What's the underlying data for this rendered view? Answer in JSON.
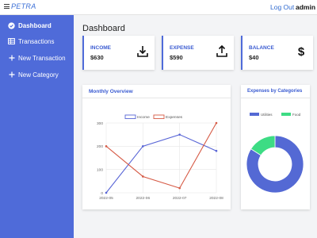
{
  "topbar": {
    "brand": "PETRA",
    "logout": "Log Out",
    "user": "admin"
  },
  "sidebar": {
    "items": [
      {
        "label": "Dashboard",
        "icon": "check-circle-icon",
        "active": true
      },
      {
        "label": "Transactions",
        "icon": "table-icon",
        "active": false
      },
      {
        "label": "New Transaction",
        "icon": "plus-icon",
        "active": false
      },
      {
        "label": "New Category",
        "icon": "plus-icon",
        "active": false
      }
    ]
  },
  "page": {
    "title": "Dashboard"
  },
  "cards": [
    {
      "label": "INCOME",
      "value": "$630",
      "icon": "download-icon"
    },
    {
      "label": "EXPENSE",
      "value": "$590",
      "icon": "upload-icon"
    },
    {
      "label": "BALANCE",
      "value": "$40",
      "icon": "dollar-icon"
    }
  ],
  "colors": {
    "accent": "#4f6bd9",
    "income": "#5865d6",
    "expense": "#d65a45",
    "utilities": "#5469d4",
    "food": "#3ddc84"
  },
  "chart_data": [
    {
      "type": "line",
      "title": "Monthly Overview",
      "categories": [
        "2022-05",
        "2022-06",
        "2022-07",
        "2022-08"
      ],
      "series": [
        {
          "name": "Income",
          "values": [
            0,
            200,
            250,
            180
          ]
        },
        {
          "name": "Expenses",
          "values": [
            200,
            70,
            20,
            300
          ]
        }
      ],
      "ylim": [
        0,
        300
      ],
      "yticks": [
        "0",
        "100",
        "200",
        "300"
      ],
      "legend": "top",
      "grid": true
    },
    {
      "type": "pie",
      "title": "Expenses by Categories",
      "categories": [
        "Utilities",
        "Food"
      ],
      "values": [
        84,
        16
      ],
      "legend": "top"
    }
  ]
}
